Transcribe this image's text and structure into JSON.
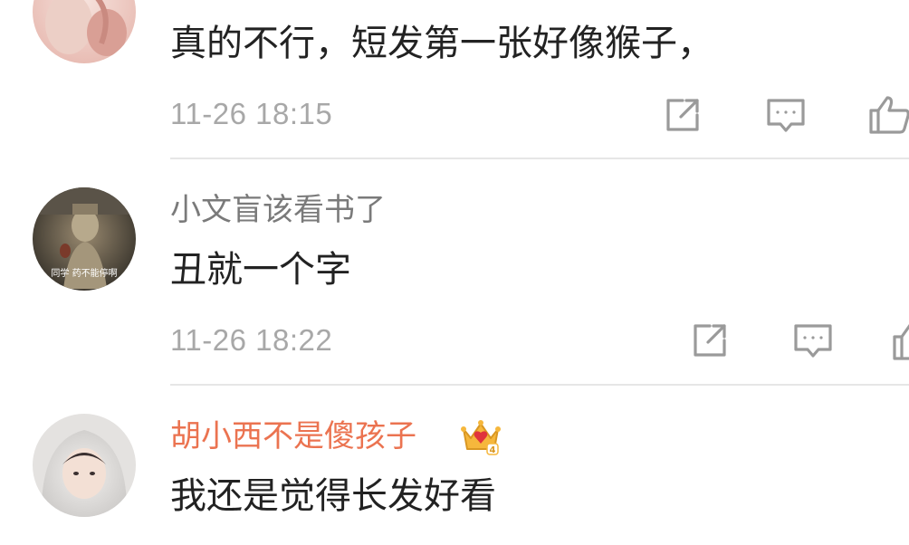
{
  "comments": [
    {
      "username": "",
      "text": "真的不行，短发第一张好像猴子，",
      "time": "11-26 18:15"
    },
    {
      "username": "小文盲该看书了",
      "avatar_caption": "同学 药不能停啊",
      "text": "丑就一个字",
      "time": "11-26 18:22"
    },
    {
      "username": "胡小西不是傻孩子",
      "text": "我还是觉得长发好看",
      "badge": "crown-vip"
    }
  ],
  "colors": {
    "vip_name": "#eb7350",
    "username": "#7a7a7a",
    "text": "#222222",
    "time": "#a8a8a8",
    "icon": "#9a9a9a"
  },
  "icons": [
    "repost-icon",
    "reply-icon",
    "like-icon",
    "crown-icon"
  ]
}
